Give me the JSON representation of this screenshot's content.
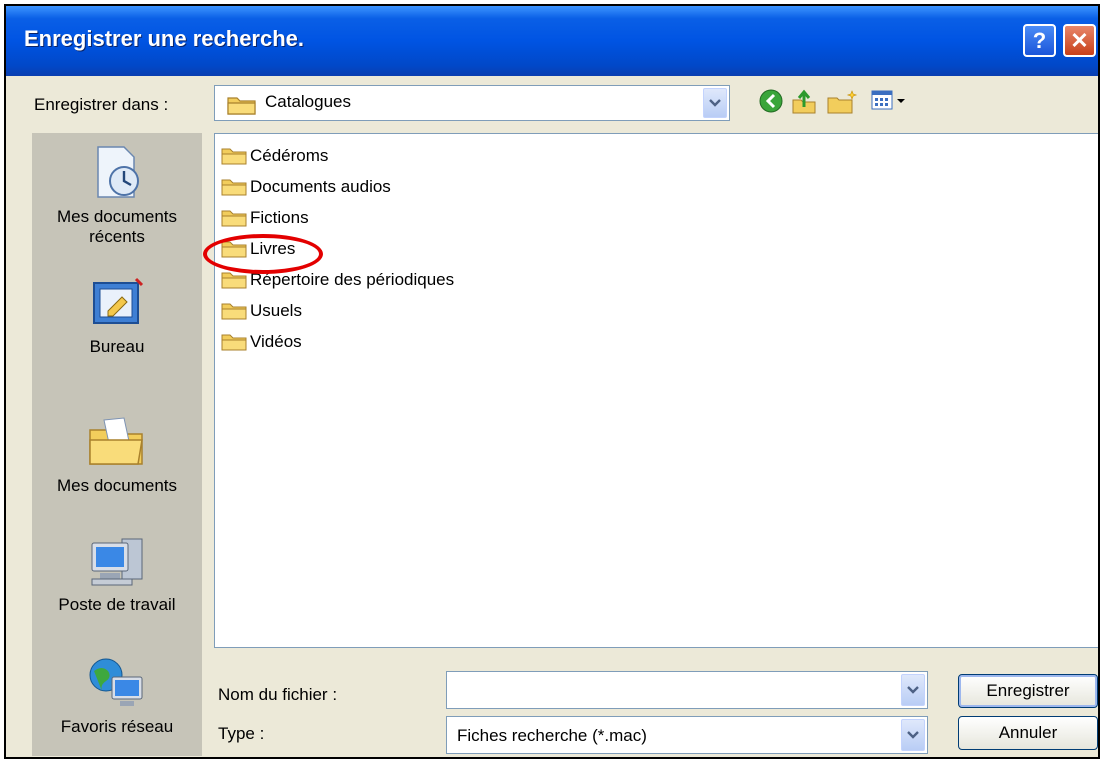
{
  "window": {
    "title": "Enregistrer une recherche.",
    "help": "?",
    "close": "✕"
  },
  "save_in": {
    "label": "Enregistrer dans :",
    "value": "Catalogues"
  },
  "toolbar": [
    "back-icon",
    "up-folder-icon",
    "new-folder-icon",
    "view-menu-icon"
  ],
  "places": [
    {
      "label": "Mes documents récents",
      "icon": "recent-documents-icon"
    },
    {
      "label": "Bureau",
      "icon": "desktop-icon"
    },
    {
      "label": "Mes documents",
      "icon": "my-documents-icon"
    },
    {
      "label": "Poste de travail",
      "icon": "my-computer-icon"
    },
    {
      "label": "Favoris réseau",
      "icon": "network-places-icon"
    }
  ],
  "files": [
    {
      "name": "Cédéroms"
    },
    {
      "name": "Documents audios"
    },
    {
      "name": "Fictions"
    },
    {
      "name": "Livres",
      "highlighted": true
    },
    {
      "name": "Répertoire des périodiques"
    },
    {
      "name": "Usuels"
    },
    {
      "name": "Vidéos"
    }
  ],
  "filename": {
    "label": "Nom du fichier :",
    "value": ""
  },
  "type": {
    "label": "Type :",
    "value": "Fiches recherche (*.mac)"
  },
  "buttons": {
    "save": "Enregistrer",
    "cancel": "Annuler"
  },
  "colors": {
    "title_bar": "#0054e3",
    "highlight_circle": "#e30000",
    "places_bar": "#c6c4b8"
  }
}
